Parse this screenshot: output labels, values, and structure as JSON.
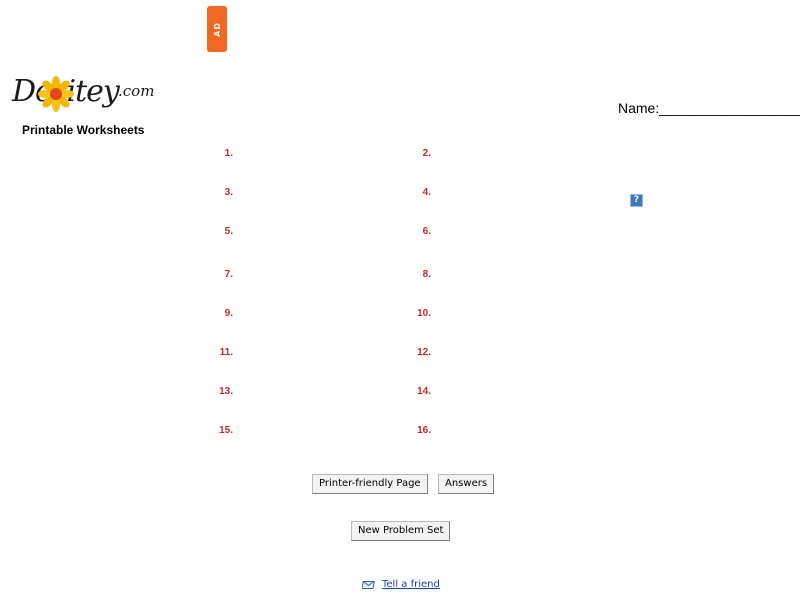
{
  "ad": {
    "label": "AD"
  },
  "logo": {
    "text": "Dositey",
    "domain": ".com"
  },
  "tagline": "Printable Worksheets",
  "name_field": "Name:____________________",
  "help_icon": {
    "glyph": "?",
    "name": "help-icon"
  },
  "problems": [
    "1.",
    "2.",
    "3.",
    "4.",
    "5.",
    "6.",
    "7.",
    "8.",
    "9.",
    "10.",
    "11.",
    "12.",
    "13.",
    "14.",
    "15.",
    "16."
  ],
  "buttons": {
    "printer_friendly": "Printer-friendly Page",
    "answers": "Answers",
    "new_problem_set": "New Problem Set"
  },
  "footer": {
    "tell_a_friend": "Tell a friend",
    "icon": "mail-icon"
  },
  "colors": {
    "problem_number": "#c62828",
    "ad_badge": "#f26722",
    "link": "#1a3fb6"
  }
}
